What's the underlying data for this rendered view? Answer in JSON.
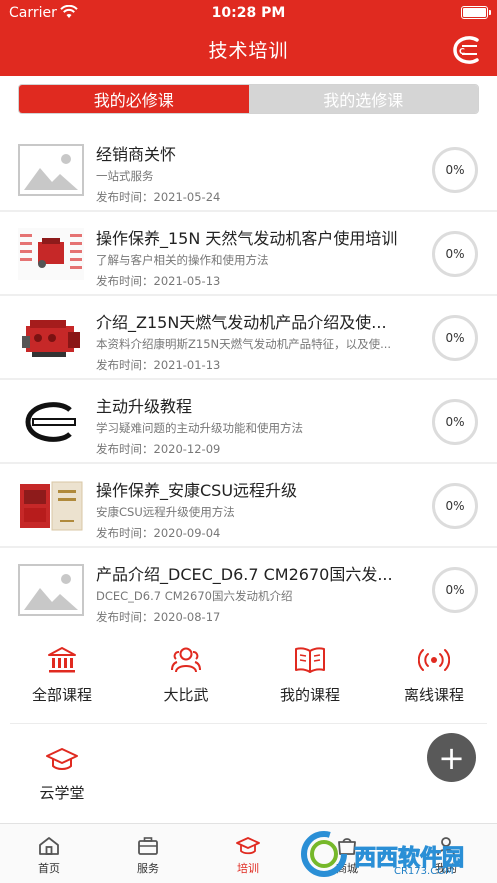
{
  "status_bar": {
    "carrier": "Carrier",
    "time": "10:28 PM",
    "wifi_icon": "wifi-icon",
    "battery_icon": "battery-icon"
  },
  "header": {
    "title": "技术培训",
    "logo_icon": "cummins-logo-icon",
    "brand_color": "#e02a20"
  },
  "segment": {
    "tabs": [
      {
        "label": "我的必修课",
        "active": true
      },
      {
        "label": "我的选修课",
        "active": false
      }
    ]
  },
  "courses": [
    {
      "title": "经销商关怀",
      "desc": "一站式服务",
      "date_label": "发布时间：",
      "date": "2021-05-24",
      "progress": "0%",
      "thumb": "placeholder-image-icon"
    },
    {
      "title": "操作保养_15N 天然气发动机客户使用培训",
      "desc": "了解与客户相关的操作和使用方法",
      "date_label": "发布时间：",
      "date": "2021-05-13",
      "progress": "0%",
      "thumb": "engine-diagram-thumbnail"
    },
    {
      "title": "介绍_Z15N天燃气发动机产品介绍及使...",
      "desc": "本资料介绍康明斯Z15N天燃气发动机产品特征，以及使...",
      "date_label": "发布时间：",
      "date": "2021-01-13",
      "progress": "0%",
      "thumb": "red-engine-thumbnail"
    },
    {
      "title": "主动升级教程",
      "desc": "学习疑难问题的主动升级功能和使用方法",
      "date_label": "发布时间：",
      "date": "2020-12-09",
      "progress": "0%",
      "thumb": "cummins-logo-thumbnail"
    },
    {
      "title": "操作保养_安康CSU远程升级",
      "desc": "安康CSU远程升级使用方法",
      "date_label": "发布时间：",
      "date": "2020-09-04",
      "progress": "0%",
      "thumb": "engine-manual-thumbnail"
    },
    {
      "title": "产品介绍_DCEC_D6.7 CM2670国六发...",
      "desc": "DCEC_D6.7 CM2670国六发动机介绍",
      "date_label": "发布时间：",
      "date": "2020-08-17",
      "progress": "0%",
      "thumb": "placeholder-image-icon"
    }
  ],
  "functions": [
    {
      "label": "全部课程",
      "icon": "bank-icon"
    },
    {
      "label": "大比武",
      "icon": "group-icon"
    },
    {
      "label": "我的课程",
      "icon": "book-icon"
    },
    {
      "label": "离线课程",
      "icon": "offline-signal-icon"
    },
    {
      "label": "云学堂",
      "icon": "graduation-cap-icon"
    }
  ],
  "fab": {
    "label": "+",
    "icon": "plus-icon"
  },
  "tabbar": [
    {
      "label": "首页",
      "icon": "home-icon",
      "active": false
    },
    {
      "label": "服务",
      "icon": "briefcase-icon",
      "active": false
    },
    {
      "label": "培训",
      "icon": "graduation-cap-icon",
      "active": true
    },
    {
      "label": "商城",
      "icon": "shop-icon",
      "active": false
    },
    {
      "label": "我的",
      "icon": "person-icon",
      "active": false
    }
  ],
  "watermark": {
    "text": "西西软件园",
    "url": "CR173.COM"
  }
}
